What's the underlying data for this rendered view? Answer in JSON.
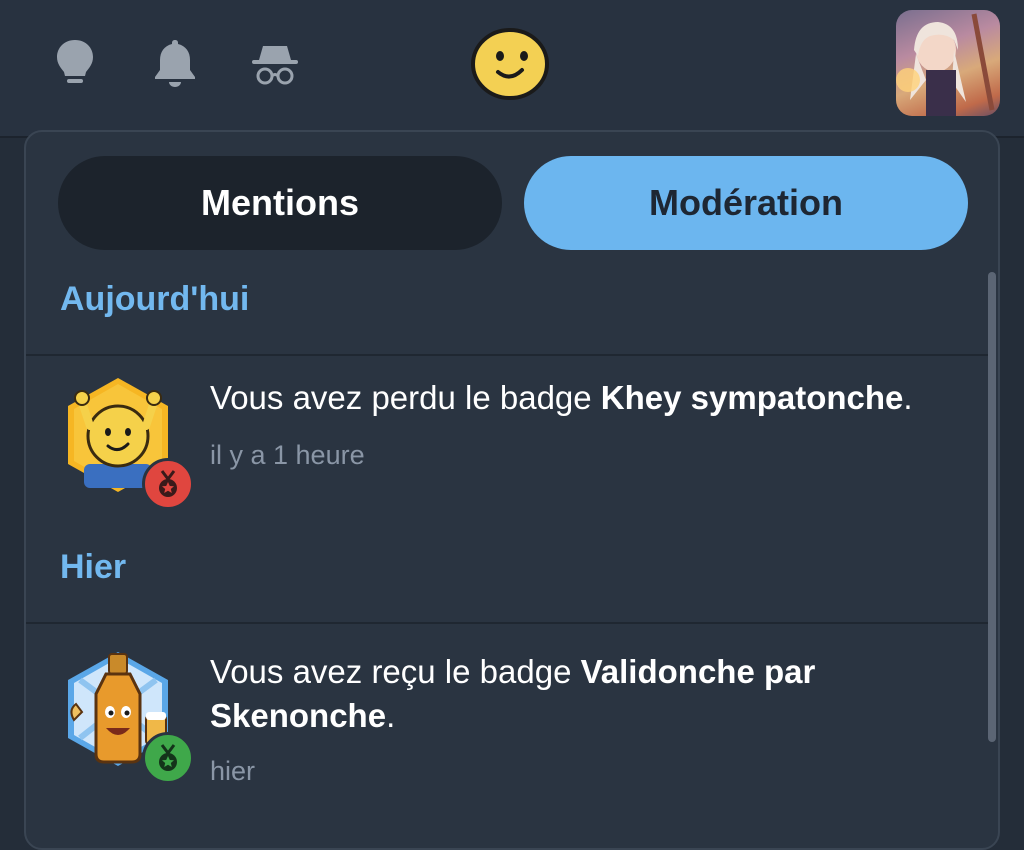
{
  "topbar": {
    "icons": [
      "lightbulb-icon",
      "bell-icon",
      "incognito-icon"
    ],
    "center_logo": "smiley-logo",
    "avatar": "user-avatar"
  },
  "tabs": [
    {
      "label": "Mentions",
      "active": false
    },
    {
      "label": "Modération",
      "active": true
    }
  ],
  "sections": [
    {
      "title": "Aujourd'hui",
      "items": [
        {
          "prefix": "Vous avez perdu le badge ",
          "badge_name": "Khey sympatonche",
          "suffix": ".",
          "time": "il y a 1 heure",
          "badge_icon": "khey-badge-icon",
          "medal_color": "#e0463f"
        }
      ]
    },
    {
      "title": "Hier",
      "items": [
        {
          "prefix": "Vous avez reçu le badge ",
          "badge_name": "Validonche par Skenonche",
          "suffix": ".",
          "time": "hier",
          "badge_icon": "beer-bottle-badge-icon",
          "medal_color": "#3fa84a"
        }
      ]
    }
  ],
  "colors": {
    "accent": "#6cb6ef",
    "background": "#2a3441",
    "section_title": "#72b8ef"
  }
}
